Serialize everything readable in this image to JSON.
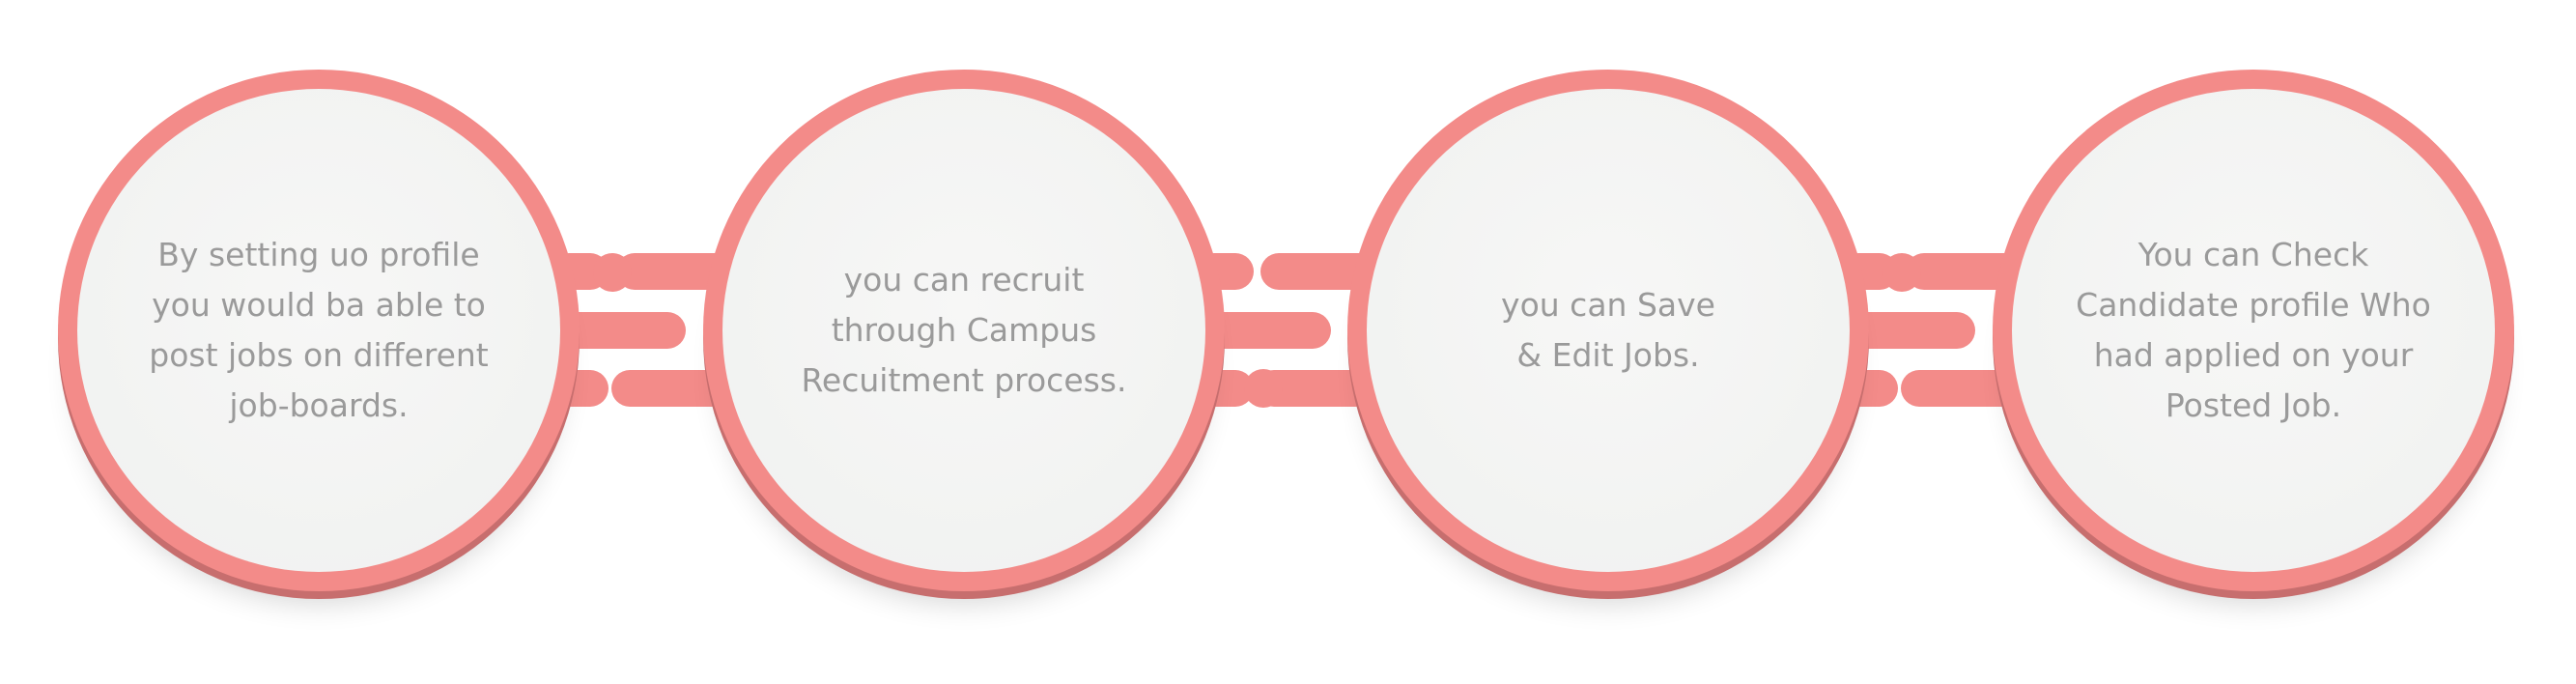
{
  "colors": {
    "ring": "#f38b89",
    "ring_shadow": "#c76e6e",
    "disc": "#f4f4f3",
    "text": "#9a9a9a",
    "background": "#ffffff"
  },
  "steps": [
    {
      "lines": [
        "By setting uo profile",
        "you would ba able to",
        "post jobs on different",
        "job-boards."
      ]
    },
    {
      "lines": [
        "you can recruit",
        "through Campus",
        "Recuitment process."
      ]
    },
    {
      "lines": [
        "you can Save",
        "& Edit Jobs."
      ]
    },
    {
      "lines": [
        "You can Check",
        "Candidate profile Who",
        "had applied on your",
        "Posted Job."
      ]
    }
  ]
}
